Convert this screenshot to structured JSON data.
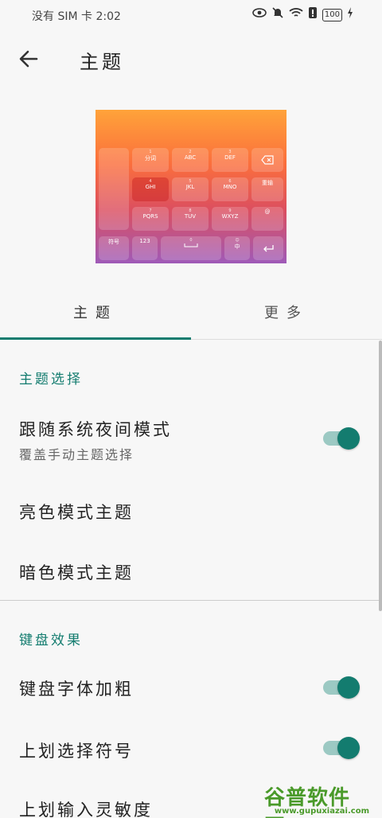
{
  "status": {
    "carrier": "没有 SIM 卡 2:02",
    "battery": "100",
    "icons": [
      "eye-icon",
      "mute-icon",
      "wifi-icon",
      "alert-icon",
      "battery-icon",
      "charging-icon"
    ]
  },
  "header": {
    "title": "主题",
    "back_icon": "arrow-left-icon"
  },
  "preview": {
    "keys": {
      "fenci": "分词",
      "abc": "ABC",
      "def": "DEF",
      "ghi": "GHI",
      "jkl": "JKL",
      "mno": "MNO",
      "chongshu": "重输",
      "pqrs": "PQRS",
      "tuv": "TUV",
      "wxyz": "WXYZ",
      "at": "@",
      "fuhao": "符号",
      "num": "123",
      "zhong": "中",
      "sub1": "1",
      "sub2": "2",
      "sub3": "3",
      "sub4": "4",
      "sub5": "5",
      "sub6": "6",
      "sub7": "7",
      "sub8": "8",
      "sub9": "9",
      "sub0": "0"
    }
  },
  "tabs": [
    {
      "label": "主题"
    },
    {
      "label": "更多"
    }
  ],
  "sections": [
    {
      "header": "主题选择",
      "items": [
        {
          "title": "跟随系统夜间模式",
          "subtitle": "覆盖手动主题选择",
          "toggle": true
        },
        {
          "title": "亮色模式主题"
        },
        {
          "title": "暗色模式主题"
        }
      ]
    },
    {
      "header": "键盘效果",
      "items": [
        {
          "title": "键盘字体加粗",
          "toggle": true
        },
        {
          "title": "上划选择符号",
          "toggle": true
        },
        {
          "title": "上划输入灵敏度"
        }
      ]
    }
  ],
  "watermark": {
    "logo": "谷普软件园",
    "url": "www.gupuxiazai.com"
  },
  "colors": {
    "accent": "#137c6f",
    "accent_track": "#9cc9c3",
    "background": "#f7f7f7"
  }
}
